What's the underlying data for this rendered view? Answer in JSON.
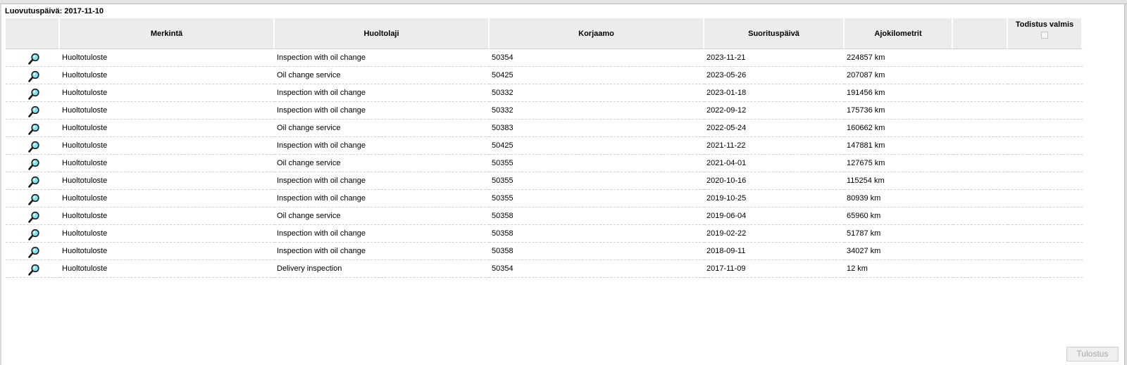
{
  "title": "Luovutuspäivä: 2017-11-10",
  "columns": {
    "merkinta": "Merkintä",
    "huoltolaji": "Huoltolaji",
    "korjaamo": "Korjaamo",
    "suorituspaiva": "Suorituspäivä",
    "ajokilometrit": "Ajokilometrit",
    "todistus_valmis": "Todistus valmis"
  },
  "rows": [
    {
      "merkinta": "Huoltotuloste",
      "huoltolaji": "Inspection with oil change",
      "korjaamo": "50354",
      "pvm": "2023-11-21",
      "km": "224857 km"
    },
    {
      "merkinta": "Huoltotuloste",
      "huoltolaji": "Oil change service",
      "korjaamo": "50425",
      "pvm": "2023-05-26",
      "km": "207087 km"
    },
    {
      "merkinta": "Huoltotuloste",
      "huoltolaji": "Inspection with oil change",
      "korjaamo": "50332",
      "pvm": "2023-01-18",
      "km": "191456 km"
    },
    {
      "merkinta": "Huoltotuloste",
      "huoltolaji": "Inspection with oil change",
      "korjaamo": "50332",
      "pvm": "2022-09-12",
      "km": "175736 km"
    },
    {
      "merkinta": "Huoltotuloste",
      "huoltolaji": "Oil change service",
      "korjaamo": "50383",
      "pvm": "2022-05-24",
      "km": "160662 km"
    },
    {
      "merkinta": "Huoltotuloste",
      "huoltolaji": "Inspection with oil change",
      "korjaamo": "50425",
      "pvm": "2021-11-22",
      "km": "147881 km"
    },
    {
      "merkinta": "Huoltotuloste",
      "huoltolaji": "Oil change service",
      "korjaamo": "50355",
      "pvm": "2021-04-01",
      "km": "127675 km"
    },
    {
      "merkinta": "Huoltotuloste",
      "huoltolaji": "Inspection with oil change",
      "korjaamo": "50355",
      "pvm": "2020-10-16",
      "km": "115254 km"
    },
    {
      "merkinta": "Huoltotuloste",
      "huoltolaji": "Inspection with oil change",
      "korjaamo": "50355",
      "pvm": "2019-10-25",
      "km": "80939 km"
    },
    {
      "merkinta": "Huoltotuloste",
      "huoltolaji": "Oil change service",
      "korjaamo": "50358",
      "pvm": "2019-06-04",
      "km": "65960 km"
    },
    {
      "merkinta": "Huoltotuloste",
      "huoltolaji": "Inspection with oil change",
      "korjaamo": "50358",
      "pvm": "2019-02-22",
      "km": "51787 km"
    },
    {
      "merkinta": "Huoltotuloste",
      "huoltolaji": "Inspection with oil change",
      "korjaamo": "50358",
      "pvm": "2018-09-11",
      "km": "34027 km"
    },
    {
      "merkinta": "Huoltotuloste",
      "huoltolaji": "Delivery inspection",
      "korjaamo": "50354",
      "pvm": "2017-11-09",
      "km": "12 km"
    }
  ],
  "row_icon": "magnifier-icon",
  "print_button": "Tulostus",
  "print_button_enabled": false
}
